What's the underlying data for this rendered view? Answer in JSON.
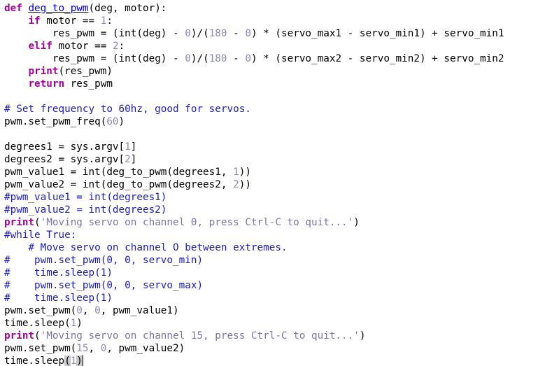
{
  "editor": {
    "lines": [
      [
        [
          "kw",
          "def"
        ],
        [
          "plain",
          " "
        ],
        [
          "fn",
          "deg_to_pwm"
        ],
        [
          "plain",
          "(deg, motor):"
        ]
      ],
      [
        [
          "plain",
          "    "
        ],
        [
          "kw",
          "if"
        ],
        [
          "plain",
          " motor == "
        ],
        [
          "num",
          "1"
        ],
        [
          "plain",
          ":"
        ]
      ],
      [
        [
          "plain",
          "        res_pwm = ("
        ],
        [
          "plain",
          "int"
        ],
        [
          "plain",
          "(deg) - "
        ],
        [
          "num",
          "0"
        ],
        [
          "plain",
          ")/("
        ],
        [
          "num",
          "180"
        ],
        [
          "plain",
          " - "
        ],
        [
          "num",
          "0"
        ],
        [
          "plain",
          ") * (servo_max1 - servo_min1) + servo_min1"
        ]
      ],
      [
        [
          "plain",
          "    "
        ],
        [
          "kw",
          "elif"
        ],
        [
          "plain",
          " motor == "
        ],
        [
          "num",
          "2"
        ],
        [
          "plain",
          ":"
        ]
      ],
      [
        [
          "plain",
          "        res_pwm = ("
        ],
        [
          "plain",
          "int"
        ],
        [
          "plain",
          "(deg) - "
        ],
        [
          "num",
          "0"
        ],
        [
          "plain",
          ")/("
        ],
        [
          "num",
          "180"
        ],
        [
          "plain",
          " - "
        ],
        [
          "num",
          "0"
        ],
        [
          "plain",
          ") * (servo_max2 - servo_min2) + servo_min2"
        ]
      ],
      [
        [
          "plain",
          "    "
        ],
        [
          "kw",
          "print"
        ],
        [
          "plain",
          "(res_pwm)"
        ]
      ],
      [
        [
          "plain",
          "    "
        ],
        [
          "kw",
          "return"
        ],
        [
          "plain",
          " res_pwm"
        ]
      ],
      [],
      [
        [
          "cmt",
          "# Set frequency to 60hz, good for servos."
        ]
      ],
      [
        [
          "plain",
          "pwm.set_pwm_freq("
        ],
        [
          "num",
          "60"
        ],
        [
          "plain",
          ")"
        ]
      ],
      [],
      [
        [
          "plain",
          "degrees1 = sys.argv["
        ],
        [
          "num",
          "1"
        ],
        [
          "plain",
          "]"
        ]
      ],
      [
        [
          "plain",
          "degrees2 = sys.argv["
        ],
        [
          "num",
          "2"
        ],
        [
          "plain",
          "]"
        ]
      ],
      [
        [
          "plain",
          "pwm_value1 = "
        ],
        [
          "plain",
          "int"
        ],
        [
          "plain",
          "(deg_to_pwm(degrees1, "
        ],
        [
          "num",
          "1"
        ],
        [
          "plain",
          "))"
        ]
      ],
      [
        [
          "plain",
          "pwm_value2 = "
        ],
        [
          "plain",
          "int"
        ],
        [
          "plain",
          "(deg_to_pwm(degrees2, "
        ],
        [
          "num",
          "2"
        ],
        [
          "plain",
          "))"
        ]
      ],
      [
        [
          "cmt",
          "#pwm_value1 = int(degrees1)"
        ]
      ],
      [
        [
          "cmt",
          "#pwm_value2 = int(degrees2)"
        ]
      ],
      [
        [
          "kw",
          "print"
        ],
        [
          "plain",
          "("
        ],
        [
          "str",
          "'Moving servo on channel 0, press Ctrl-C to quit...'"
        ],
        [
          "plain",
          ")"
        ]
      ],
      [
        [
          "cmt",
          "#while True:"
        ]
      ],
      [
        [
          "cmt",
          "    # Move servo on channel O between extremes."
        ]
      ],
      [
        [
          "cmt",
          "#    pwm.set_pwm(0, 0, servo_min)"
        ]
      ],
      [
        [
          "cmt",
          "#    time.sleep(1)"
        ]
      ],
      [
        [
          "cmt",
          "#    pwm.set_pwm(0, 0, servo_max)"
        ]
      ],
      [
        [
          "cmt",
          "#    time.sleep(1)"
        ]
      ],
      [
        [
          "plain",
          "pwm.set_pwm("
        ],
        [
          "num",
          "0"
        ],
        [
          "plain",
          ", "
        ],
        [
          "num",
          "0"
        ],
        [
          "plain",
          ", pwm_value1)"
        ]
      ],
      [
        [
          "plain",
          "time.sleep("
        ],
        [
          "num",
          "1"
        ],
        [
          "plain",
          ")"
        ]
      ],
      [
        [
          "kw",
          "print"
        ],
        [
          "plain",
          "("
        ],
        [
          "str",
          "'Moving servo on channel 15, press Ctrl-C to quit...'"
        ],
        [
          "plain",
          ")"
        ]
      ],
      [
        [
          "plain",
          "pwm.set_pwm("
        ],
        [
          "num",
          "15"
        ],
        [
          "plain",
          ", "
        ],
        [
          "num",
          "0"
        ],
        [
          "plain",
          ", pwm_value2)"
        ]
      ],
      [
        [
          "plain",
          "time.sleep"
        ],
        [
          "hl",
          "("
        ],
        [
          "num",
          "1"
        ],
        [
          "hl",
          ")"
        ],
        [
          "caret",
          ""
        ]
      ]
    ]
  }
}
